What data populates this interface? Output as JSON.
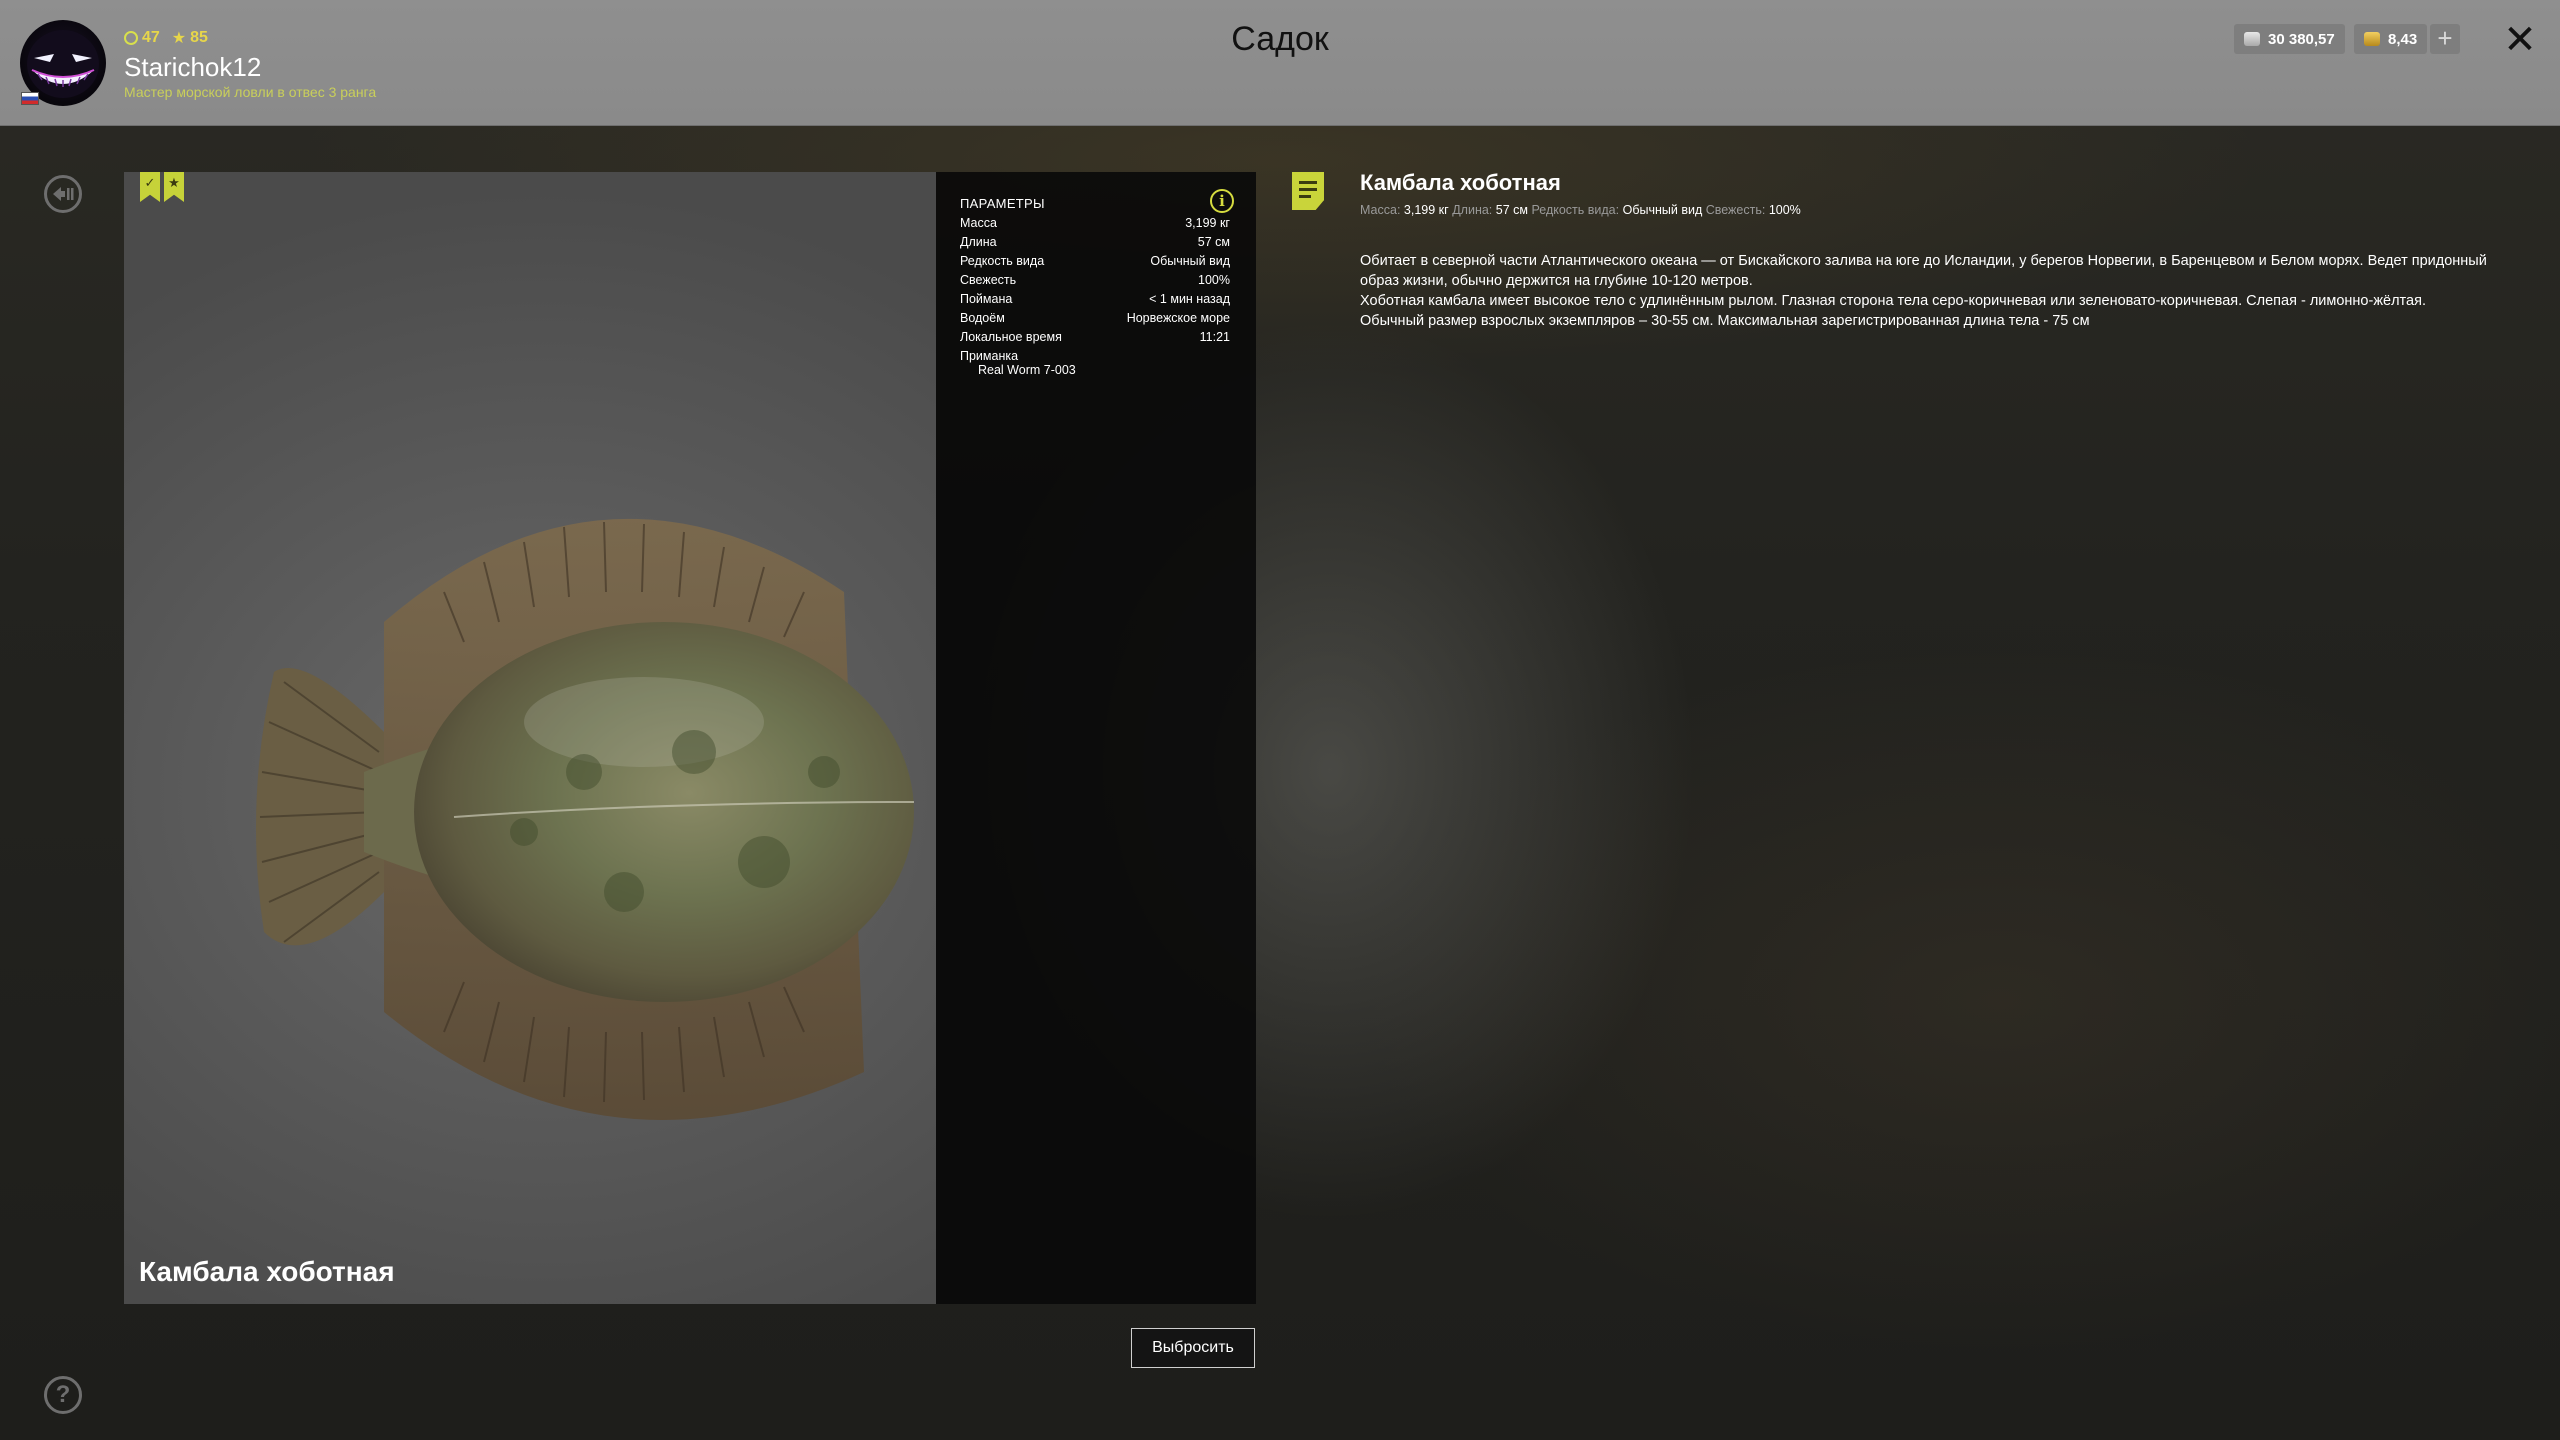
{
  "header": {
    "page_title": "Садок",
    "user": {
      "level": "47",
      "stars": "85",
      "name": "Starichok12",
      "rank": "Мастер морской ловли в отвес 3 ранга"
    },
    "silver_balance": "30 380,57",
    "gold_balance": "8,43",
    "plus_label": "+",
    "close_label": "✕"
  },
  "fish_card": {
    "name": "Камбала хоботная",
    "params_title": "ПАРАМЕТРЫ",
    "params": [
      {
        "label": "Масса",
        "value": "3,199 кг"
      },
      {
        "label": "Длина",
        "value": "57 см"
      },
      {
        "label": "Редкость вида",
        "value": "Обычный вид"
      },
      {
        "label": "Свежесть",
        "value": "100%"
      },
      {
        "label": "Поймана",
        "value": "< 1 мин назад"
      },
      {
        "label": "Водоём",
        "value": "Норвежское море"
      },
      {
        "label": "Локальное время",
        "value": "11:21"
      }
    ],
    "lure_label": "Приманка",
    "lure_value": "Real Worm 7-003"
  },
  "release_button": "Выбросить",
  "help_label": "?",
  "description": {
    "title": "Камбала хоботная",
    "summary": {
      "mass_label": "Масса:",
      "mass": "3,199 кг",
      "length_label": "Длина:",
      "length": "57 см",
      "rarity_label": "Редкость вида:",
      "rarity": "Обычный вид",
      "freshness_label": "Свежесть:",
      "freshness": "100%"
    },
    "paragraphs": [
      "Обитает в северной части Атлантического океана — от Бискайского залива на юге до Исландии, у берегов Норвегии, в Баренцевом и Белом морях. Ведет придонный образ жизни, обычно держится на глубине 10-120 метров.",
      "Хоботная камбала имеет высокое тело с удлинённым рылом. Глазная сторона тела серо-коричневая или зеленовато-коричневая. Слепая - лимонно-жёлтая.",
      "Обычный размер взрослых экземпляров – 30-55 см. Максимальная зарегистрированная длина тела - 75 см"
    ]
  },
  "colors": {
    "accent": "#c9d43a",
    "topbar": "#8c8c8c",
    "params_bg": "#0a0a0a"
  },
  "icons": [
    "avatar",
    "flag-ru",
    "level-icon",
    "star-icon",
    "silver-coin-icon",
    "gold-coin-icon",
    "plus-icon",
    "close-icon",
    "back-icon",
    "help-icon",
    "bookmark-check-icon",
    "bookmark-star-icon",
    "info-icon",
    "notes-icon"
  ]
}
